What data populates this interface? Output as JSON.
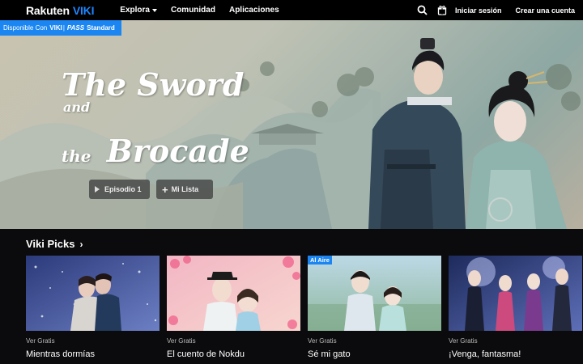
{
  "brand": {
    "part1": "Rakuten",
    "part2": "VIKI",
    "accent": "#1e86ff"
  },
  "nav": {
    "explore": "Explora",
    "community": "Comunidad",
    "apps": "Aplicaciones",
    "login": "Iniciar sesión",
    "signup": "Crear una cuenta",
    "icons": [
      "search-icon",
      "gift-icon"
    ]
  },
  "hero": {
    "badge_prefix": "Disponible Con",
    "badge_brand": "VIKI",
    "badge_pass": "PASS",
    "badge_suffix": "Standard",
    "title_line1": "The Sword",
    "title_and": "and",
    "title_the": "the",
    "title_line2": "Brocade",
    "btn_episode": "Episodio 1",
    "btn_list": "Mi Lista"
  },
  "picks": {
    "heading": "Viki Picks",
    "cards": [
      {
        "tag": "Ver Gratis",
        "title": "Mientras dormías",
        "badge": ""
      },
      {
        "tag": "Ver Gratis",
        "title": "El cuento de Nokdu",
        "badge": ""
      },
      {
        "tag": "Ver Gratis",
        "title": "Sé mi gato",
        "badge": "Al Aire"
      },
      {
        "tag": "Ver Gratis",
        "title": "¡Venga, fantasma!",
        "badge": ""
      }
    ]
  }
}
